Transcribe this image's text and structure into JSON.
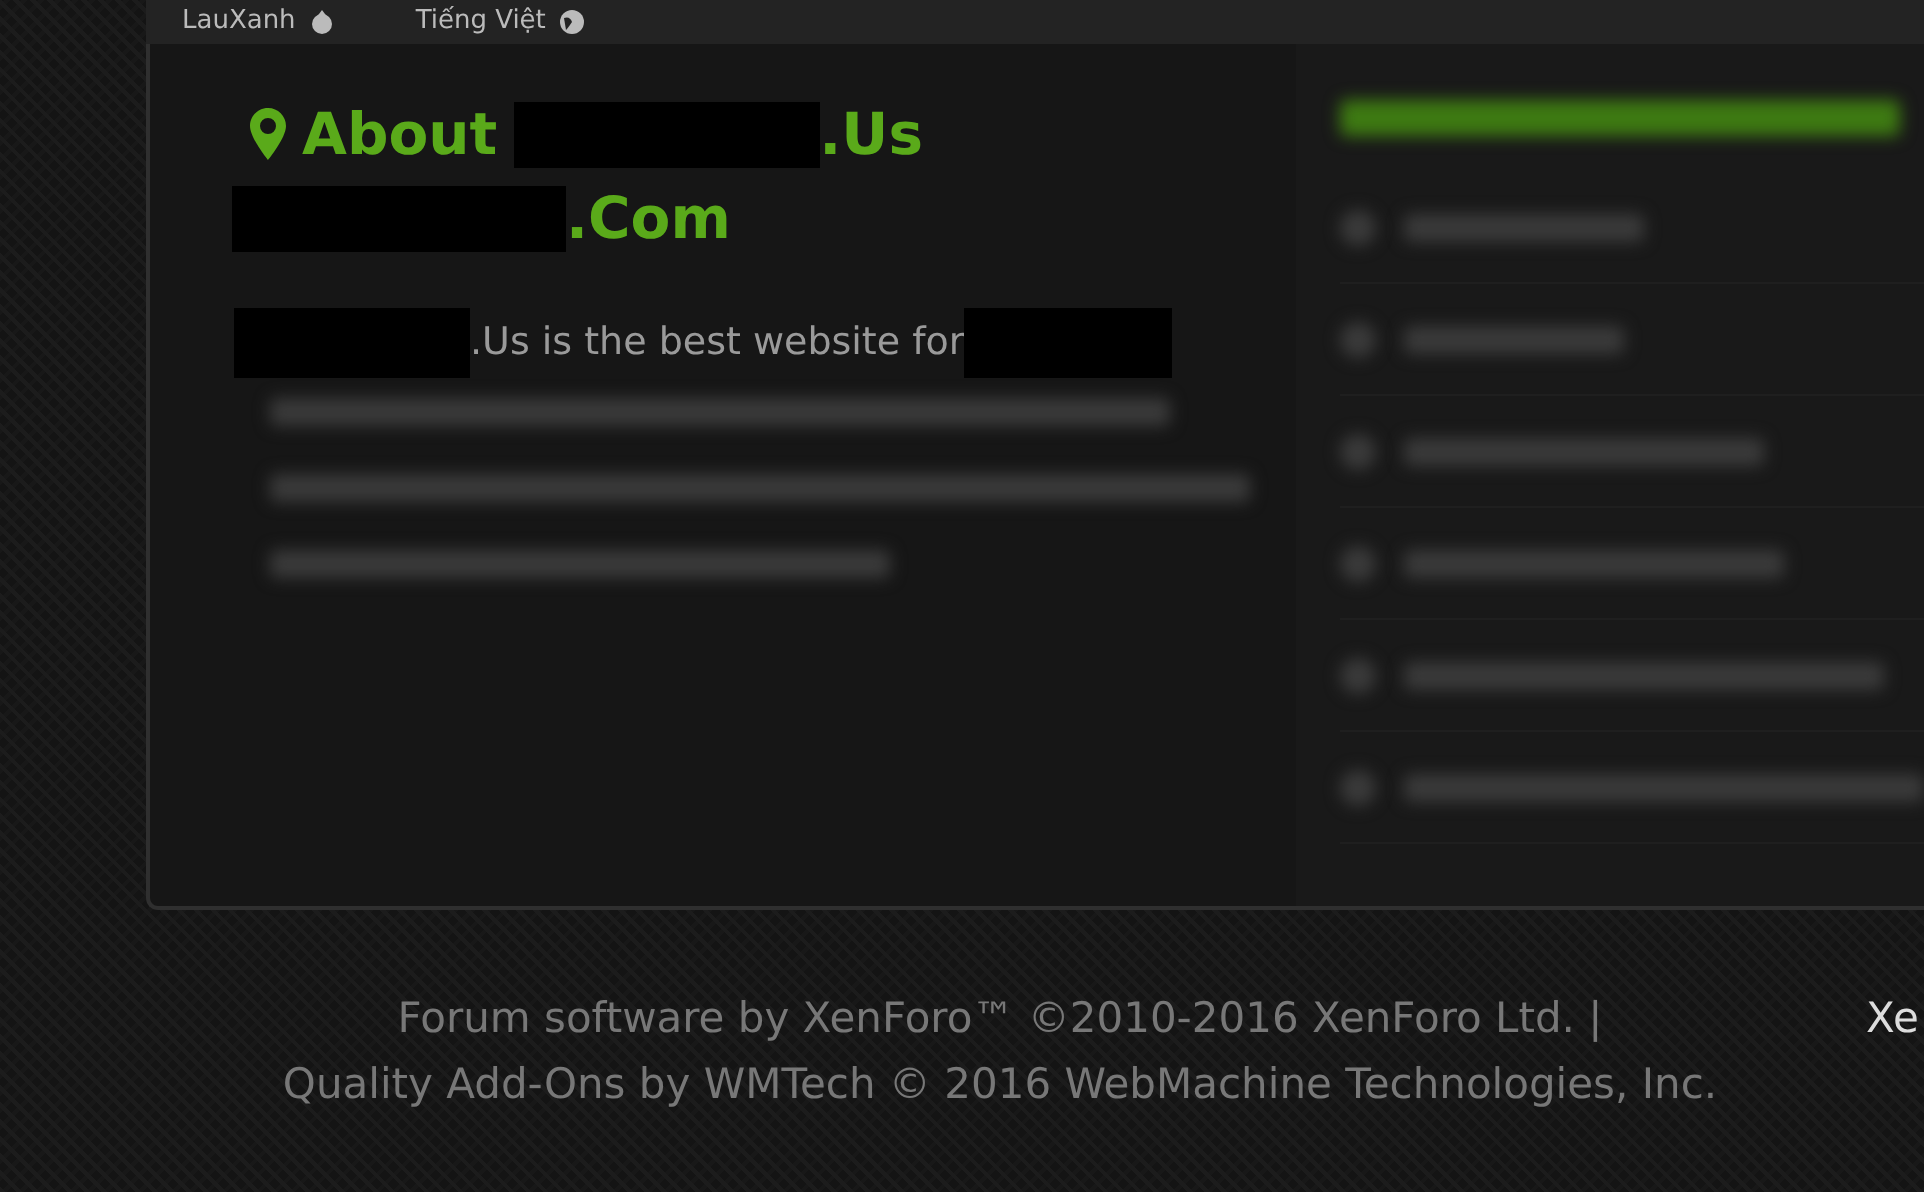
{
  "top_bar": {
    "links": [
      {
        "label": "LauXanh",
        "kind": "drop"
      },
      {
        "label": "Tiếng Việt",
        "kind": "globe"
      }
    ]
  },
  "about": {
    "title_lines": [
      [
        {
          "kind": "icon"
        },
        {
          "kind": "text",
          "text": "About"
        },
        {
          "kind": "redacted"
        },
        {
          "kind": "text",
          "text": ".Us"
        }
      ],
      [
        {
          "kind": "redacted"
        },
        {
          "kind": "text",
          "text": ".Com"
        }
      ]
    ],
    "description": [
      {
        "kind": "redacted"
      },
      {
        "kind": "text",
        "text": ".Us is the best website for"
      },
      {
        "kind": "redacted"
      }
    ]
  },
  "footer": {
    "lines": [
      "Forum software by XenForo™ ©2010-2016 XenForo Ltd. |",
      "Quality Add-Ons by WMTech © 2016 WebMachine Technologies, Inc."
    ],
    "side_link": "Xe"
  }
}
